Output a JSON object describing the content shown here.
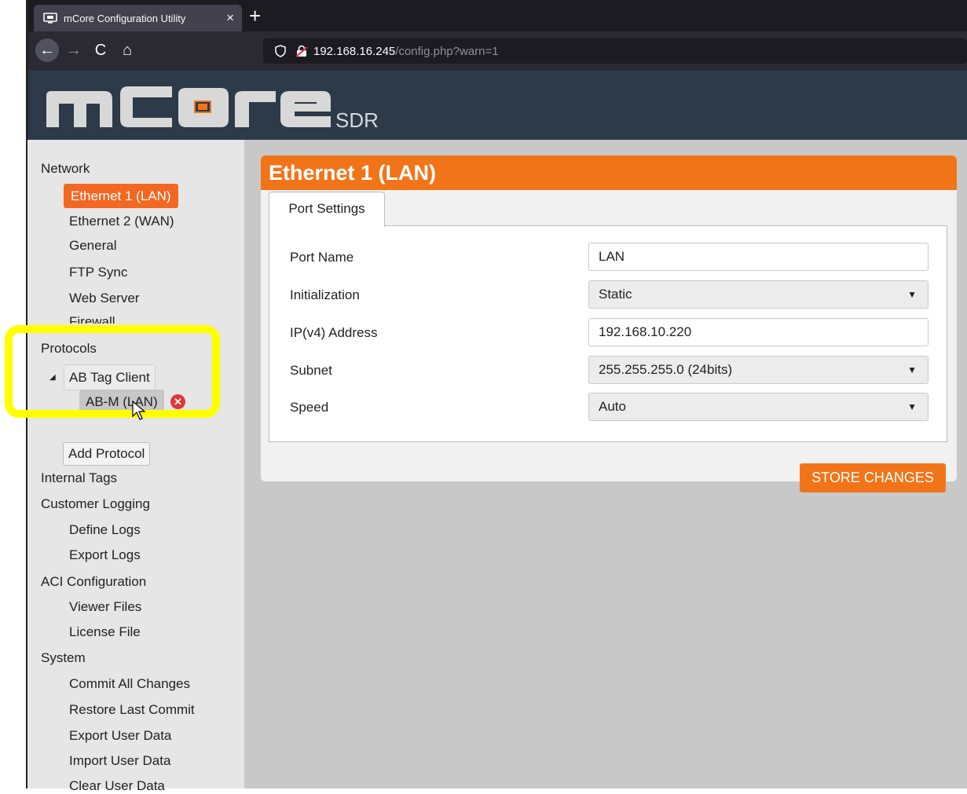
{
  "browser": {
    "tab_title": "mCore Configuration Utility",
    "tab_close": "×",
    "new_tab": "+",
    "nav_back": "←",
    "nav_forward": "→",
    "nav_reload": "C",
    "nav_home": "⌂",
    "url_host": "192.168.16.245",
    "url_path": "/config.php?warn=1"
  },
  "logo": {
    "main": "mCore",
    "sub": "SDR"
  },
  "sidebar": {
    "network": "Network",
    "ethernet1": "Ethernet 1 (LAN)",
    "ethernet2": "Ethernet 2 (WAN)",
    "general": "General",
    "ftp_sync": "FTP Sync",
    "web_server": "Web Server",
    "firewall": "Firewall",
    "protocols": "Protocols",
    "ab_tag_client": "AB Tag Client",
    "ab_m": "AB-M (LAN)",
    "add_protocol": "Add Protocol",
    "internal_tags": "Internal Tags",
    "customer_logging": "Customer Logging",
    "define_logs": "Define Logs",
    "export_logs": "Export Logs",
    "aci_configuration": "ACI Configuration",
    "viewer_files": "Viewer Files",
    "license_file": "License File",
    "system": "System",
    "commit_all": "Commit All Changes",
    "restore_last": "Restore Last Commit",
    "export_user": "Export User Data",
    "import_user": "Import User Data",
    "clear_user": "Clear User Data"
  },
  "main": {
    "title": "Ethernet 1 (LAN)",
    "tab": "Port Settings",
    "fields": {
      "port_name_label": "Port Name",
      "port_name_value": "LAN",
      "init_label": "Initialization",
      "init_value": "Static",
      "ip_label": "IP(v4) Address",
      "ip_value": "192.168.10.220",
      "subnet_label": "Subnet",
      "subnet_value": "255.255.255.0 (24bits)",
      "speed_label": "Speed",
      "speed_value": "Auto"
    },
    "store_button": "STORE CHANGES"
  },
  "colors": {
    "accent": "#f27419",
    "banner": "#2c3a49",
    "highlight": "#ffff00"
  }
}
